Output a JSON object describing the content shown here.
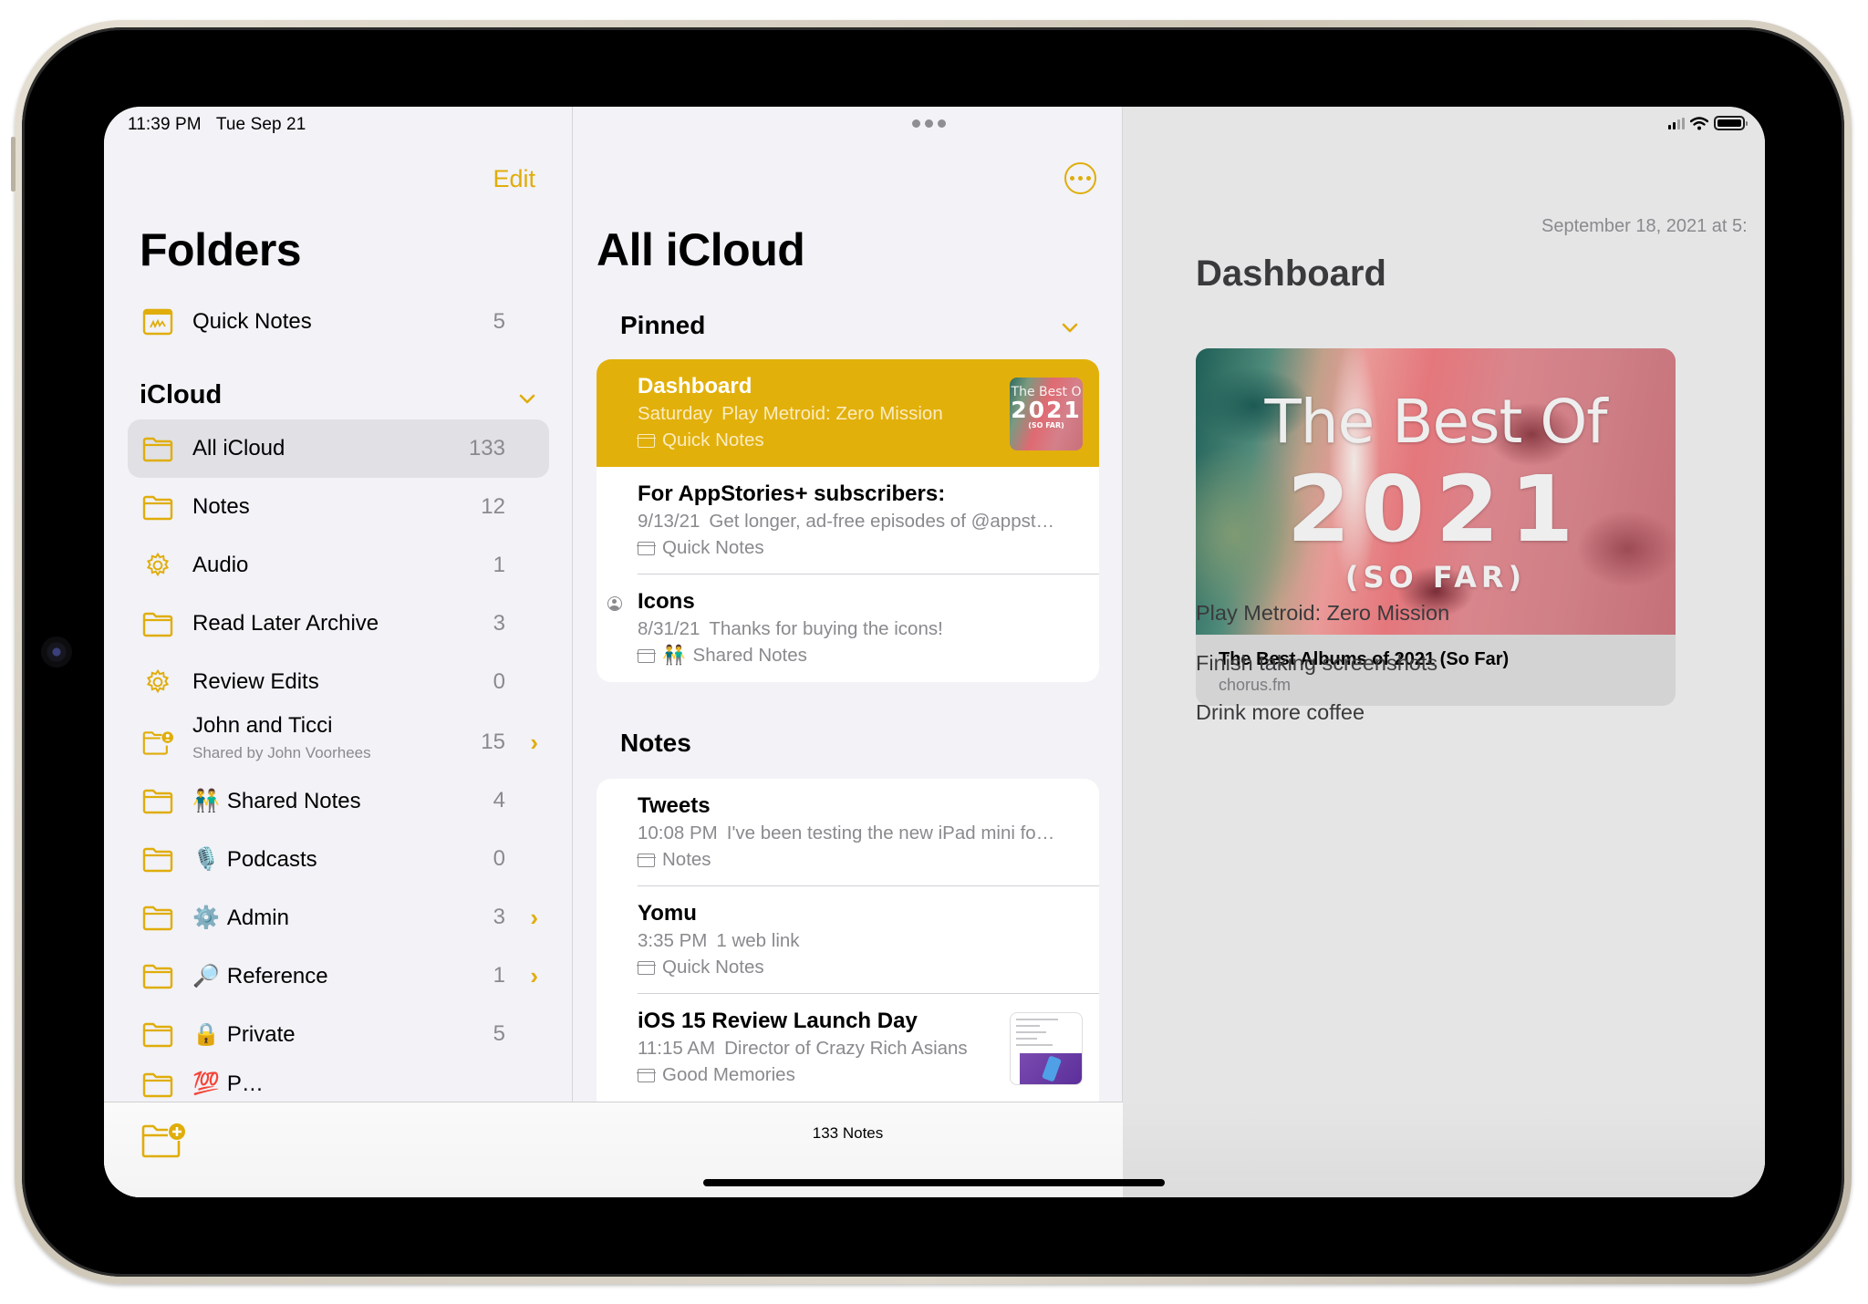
{
  "status_bar": {
    "time": "11:39 PM",
    "date": "Tue Sep 21",
    "icons": [
      "cellular-signal-icon",
      "wifi-icon",
      "battery-icon"
    ]
  },
  "accent_color": "#e0ad0a",
  "sidebar": {
    "edit_label": "Edit",
    "title": "Folders",
    "quick_notes": {
      "label": "Quick Notes",
      "count": "5",
      "icon": "quick-note-icon"
    },
    "icloud_section": {
      "title": "iCloud",
      "expanded": true
    },
    "folders": [
      {
        "label": "All iCloud",
        "count": "133",
        "icon": "folder-icon",
        "selected": true
      },
      {
        "label": "Notes",
        "count": "12",
        "icon": "folder-icon"
      },
      {
        "label": "Audio",
        "count": "1",
        "icon": "smart-folder-gear-icon"
      },
      {
        "label": "Read Later Archive",
        "count": "3",
        "icon": "folder-icon"
      },
      {
        "label": "Review Edits",
        "count": "0",
        "icon": "smart-folder-gear-icon"
      },
      {
        "label": "John and Ticci",
        "subtitle": "Shared by John Voorhees",
        "count": "15",
        "icon": "shared-folder-icon",
        "has_children": true
      },
      {
        "emoji": "👬",
        "label": "Shared Notes",
        "count": "4",
        "icon": "folder-icon"
      },
      {
        "emoji": "🎙️",
        "label": "Podcasts",
        "count": "0",
        "icon": "folder-icon"
      },
      {
        "emoji": "⚙️",
        "label": "Admin",
        "count": "3",
        "icon": "folder-icon",
        "has_children": true
      },
      {
        "emoji": "🔎",
        "label": "Reference",
        "count": "1",
        "icon": "folder-icon",
        "has_children": true
      },
      {
        "emoji": "🔒",
        "label": "Private",
        "count": "5",
        "icon": "folder-icon"
      },
      {
        "emoji": "💯",
        "label": "P…",
        "count": "",
        "icon": "folder-icon",
        "partially_visible": true
      }
    ],
    "new_folder_icon": "new-folder-icon"
  },
  "note_list": {
    "title": "All iCloud",
    "more_icon": "ellipsis-circle-icon",
    "pinned_section": "Pinned",
    "pinned": [
      {
        "title": "Dashboard",
        "date": "Saturday",
        "preview": "Play Metroid: Zero Mission",
        "folder": "Quick Notes",
        "selected": true,
        "thumbnail": {
          "line1": "The Best O",
          "line2": "2021",
          "line3": "(SO FAR)"
        }
      },
      {
        "title": "For AppStories+ subscribers:",
        "date": "9/13/21",
        "preview": "Get longer, ad-free episodes of @appst…",
        "folder": "Quick Notes"
      },
      {
        "title": "Icons",
        "date": "8/31/21",
        "preview": "Thanks for buying the icons!",
        "folder_emoji": "👬",
        "folder": "Shared Notes",
        "shared": true
      }
    ],
    "notes_section": "Notes",
    "notes": [
      {
        "title": "Tweets",
        "date": "10:08 PM",
        "preview": "I've been testing the new iPad mini fo…",
        "folder": "Notes"
      },
      {
        "title": "Yomu",
        "date": "3:35 PM",
        "preview": "1 web link",
        "folder": "Quick Notes"
      },
      {
        "title": "iOS 15 Review Launch Day",
        "date": "11:15 AM",
        "preview": "Director of Crazy Rich Asians",
        "folder": "Good Memories",
        "has_thumbnail": true
      }
    ],
    "footer_count": "133 Notes"
  },
  "detail": {
    "timestamp": "September 18, 2021 at 5:",
    "title": "Dashboard",
    "link_card": {
      "image_text_1": "The Best Of",
      "image_text_2": "2021",
      "image_text_3": "(SO FAR)",
      "title": "The Best Albums of 2021 (So Far)",
      "domain": "chorus.fm"
    },
    "lines": [
      "Play Metroid: Zero Mission",
      "Finish taking screenshots",
      "Drink more coffee"
    ]
  }
}
